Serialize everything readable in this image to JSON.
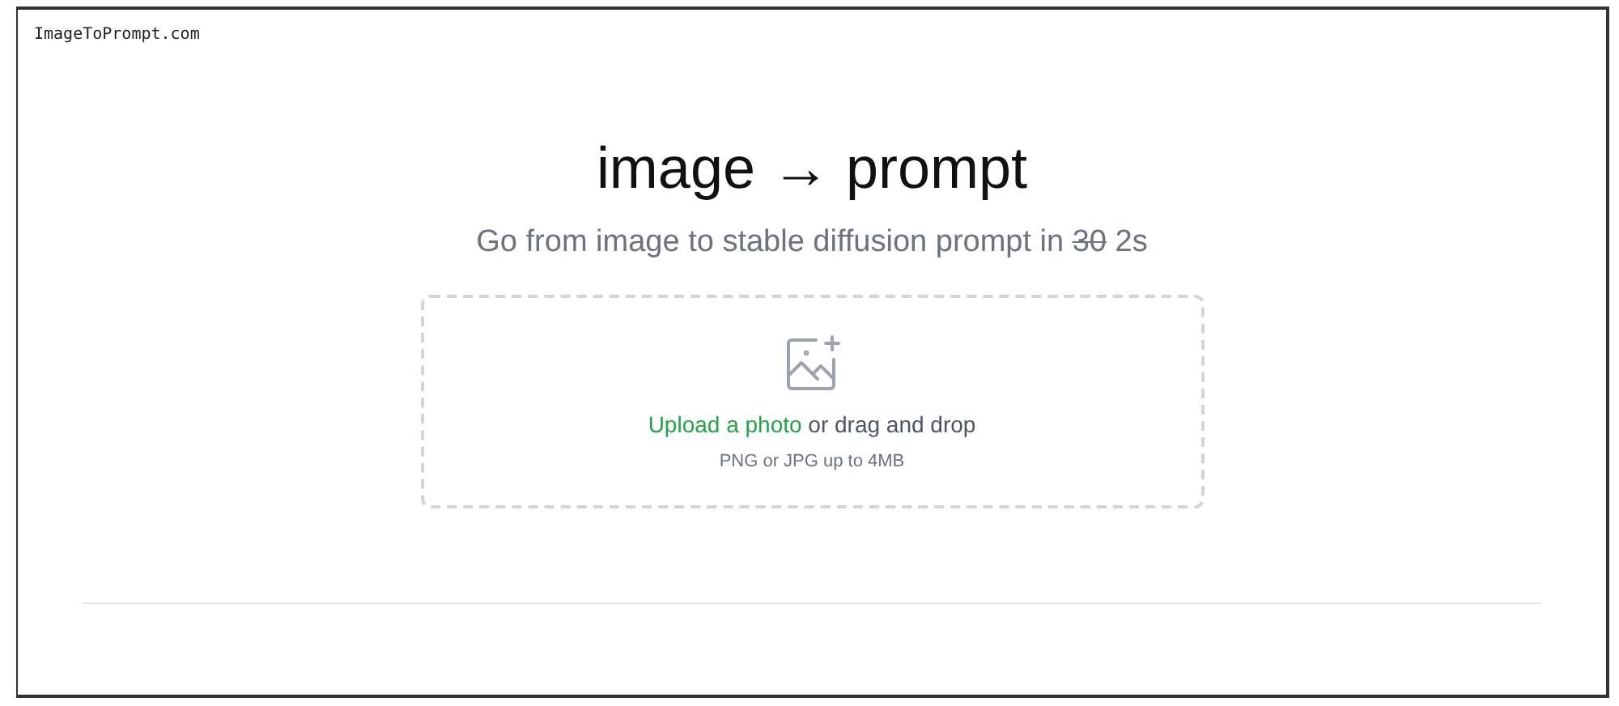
{
  "site_name": "ImageToPrompt.com",
  "title": "image → prompt",
  "subtitle": {
    "before": "Go from image to stable diffusion prompt in ",
    "struck": "30",
    "after": " 2s"
  },
  "upload": {
    "link": "Upload a photo",
    "text": " or drag and drop",
    "hint": "PNG or JPG up to 4MB"
  }
}
